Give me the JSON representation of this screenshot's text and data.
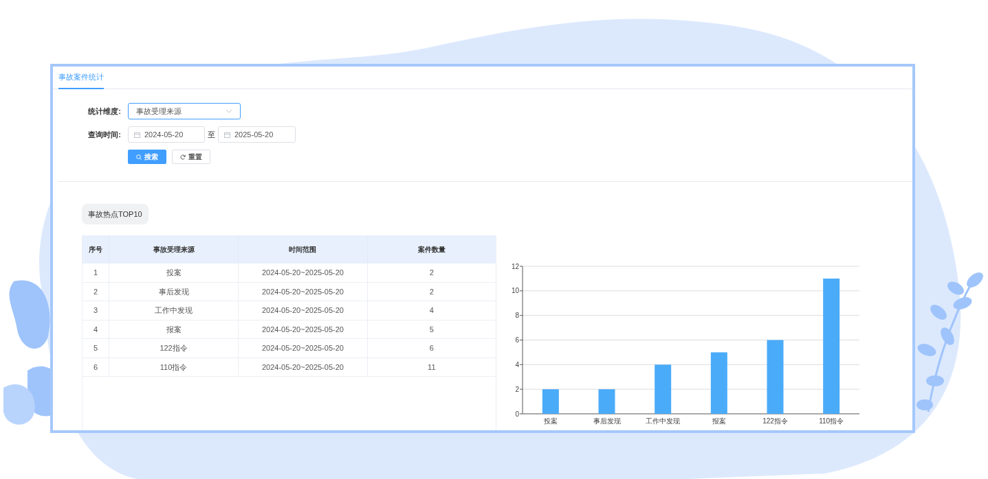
{
  "tabs": [
    {
      "label": "事故案件统计",
      "selected": true
    }
  ],
  "form": {
    "dimension": {
      "label": "统计维度:",
      "value": "事故受理来源"
    },
    "time": {
      "label": "查询时间:",
      "start": "2024-05-20",
      "separator": "至",
      "end": "2025-05-20"
    },
    "buttons": [
      {
        "kind": "primary",
        "label": "搜索"
      },
      {
        "kind": "default",
        "label": "重置"
      }
    ]
  },
  "section_badge": "事故热点TOP10",
  "table": {
    "columns": [
      "序号",
      "事故受理来源",
      "时间范围",
      "案件数量"
    ],
    "rows": [
      [
        "1",
        "投案",
        "2024-05-20~2025-05-20",
        "2"
      ],
      [
        "2",
        "事后发现",
        "2024-05-20~2025-05-20",
        "2"
      ],
      [
        "3",
        "工作中发现",
        "2024-05-20~2025-05-20",
        "4"
      ],
      [
        "4",
        "报案",
        "2024-05-20~2025-05-20",
        "5"
      ],
      [
        "5",
        "122指令",
        "2024-05-20~2025-05-20",
        "6"
      ],
      [
        "6",
        "110指令",
        "2024-05-20~2025-05-20",
        "11"
      ]
    ]
  },
  "chart_data": {
    "type": "bar",
    "categories": [
      "投案",
      "事后发现",
      "工作中发现",
      "报案",
      "122指令",
      "110指令"
    ],
    "series": [
      {
        "color": "#4aabf9",
        "values": [
          2,
          2,
          4,
          5,
          6,
          11
        ]
      }
    ],
    "ylim": [
      0,
      12
    ],
    "yticks": [
      0,
      2,
      4,
      6,
      8,
      10,
      12
    ],
    "grid": true
  }
}
